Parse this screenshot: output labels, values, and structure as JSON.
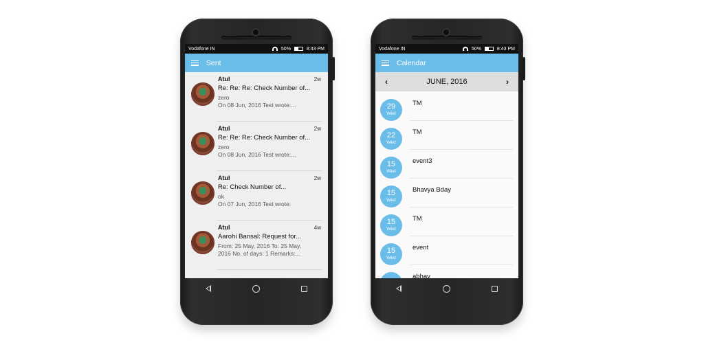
{
  "phones": {
    "left": {
      "status": {
        "carrier": "Vodafone IN",
        "battery": "50%",
        "time": "8:43 PM"
      },
      "app_bar_title": "Sent",
      "emails": [
        {
          "sender": "Atul",
          "time": "2w",
          "subject": "Re: Re: Re: Check Number of...",
          "line1": "zero",
          "line2": "On 08 Jun, 2016 Test wrote:..."
        },
        {
          "sender": "Atul",
          "time": "2w",
          "subject": "Re: Re: Re: Check Number of...",
          "line1": "zero",
          "line2": "On 08 Jun, 2016 Test wrote:..."
        },
        {
          "sender": "Atul",
          "time": "2w",
          "subject": "Re: Check Number of...",
          "line1": "ok",
          "line2": "On 07 Jun, 2016 Test wrote:"
        },
        {
          "sender": "Atul",
          "time": "4w",
          "subject": "Aarohi  Bansal: Request for...",
          "line1": "From: 25 May, 2016 To: 25 May,",
          "line2": "2016 No. of days: 1 Remarks:..."
        }
      ]
    },
    "right": {
      "status": {
        "carrier": "Vodafone IN",
        "battery": "50%",
        "time": "8:43 PM"
      },
      "app_bar_title": "Calendar",
      "month": "JUNE, 2016",
      "prev_icon": "‹",
      "next_icon": "›",
      "events": [
        {
          "day": "29",
          "dow": "Wed",
          "name": "TM"
        },
        {
          "day": "22",
          "dow": "Wed",
          "name": "TM"
        },
        {
          "day": "15",
          "dow": "Wed",
          "name": "event3"
        },
        {
          "day": "15",
          "dow": "Wed",
          "name": "Bhavya Bday"
        },
        {
          "day": "15",
          "dow": "Wed",
          "name": "TM"
        },
        {
          "day": "15",
          "dow": "Wed",
          "name": "event"
        },
        {
          "day": "",
          "dow": "",
          "name": "abhay"
        }
      ]
    }
  },
  "colors": {
    "accent": "#6bbde9",
    "status_bar": "#111111",
    "phone_body": "#262626"
  }
}
